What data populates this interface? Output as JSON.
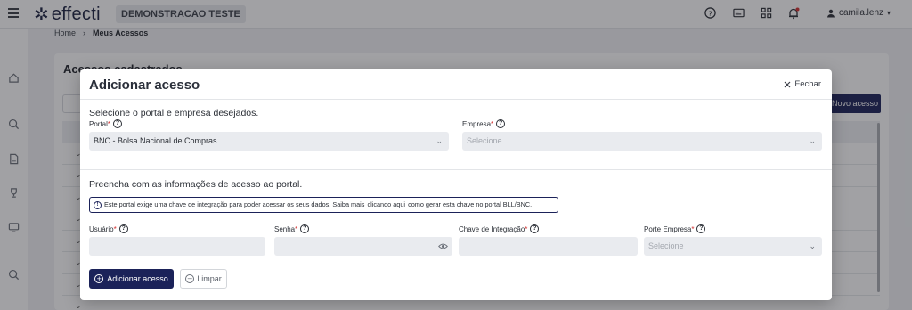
{
  "topbar": {
    "brand": "effecti",
    "environment": "DEMONSTRACAO TESTE",
    "user": "camila.lenz",
    "icons": [
      "menu-icon",
      "help-icon",
      "id-card-icon",
      "apps-icon",
      "bell-icon",
      "user-icon"
    ]
  },
  "breadcrumb": {
    "home": "Home",
    "separator": "›",
    "current": "Meus Acessos"
  },
  "page": {
    "title": "Acessos cadastrados",
    "new_button": "Novo acesso"
  },
  "modal": {
    "title": "Adicionar acesso",
    "close_label": "Fechar",
    "section1": "Selecione o portal e empresa desejados.",
    "portal": {
      "label": "Portal",
      "value": "BNC - Bolsa Nacional de Compras"
    },
    "empresa": {
      "label": "Empresa",
      "placeholder": "Selecione"
    },
    "section2": "Preencha com as informações de acesso ao portal.",
    "notice": {
      "text_before": "Este portal exige uma chave de integração para poder acessar os seus dados. Saiba mais ",
      "link": "clicando aqui",
      "text_after": " como gerar esta chave no portal BLL/BNC."
    },
    "usuario": {
      "label": "Usuário",
      "value": ""
    },
    "senha": {
      "label": "Senha",
      "value": ""
    },
    "chave": {
      "label": "Chave de Integração",
      "value": ""
    },
    "porte": {
      "label": "Porte Empresa",
      "placeholder": "Selecione"
    },
    "required_mark": "*",
    "add_button": "Adicionar acesso",
    "clear_button": "Limpar"
  },
  "colors": {
    "primary": "#1b2259",
    "required": "#d32f2f",
    "field_bg": "#e9ebef"
  }
}
